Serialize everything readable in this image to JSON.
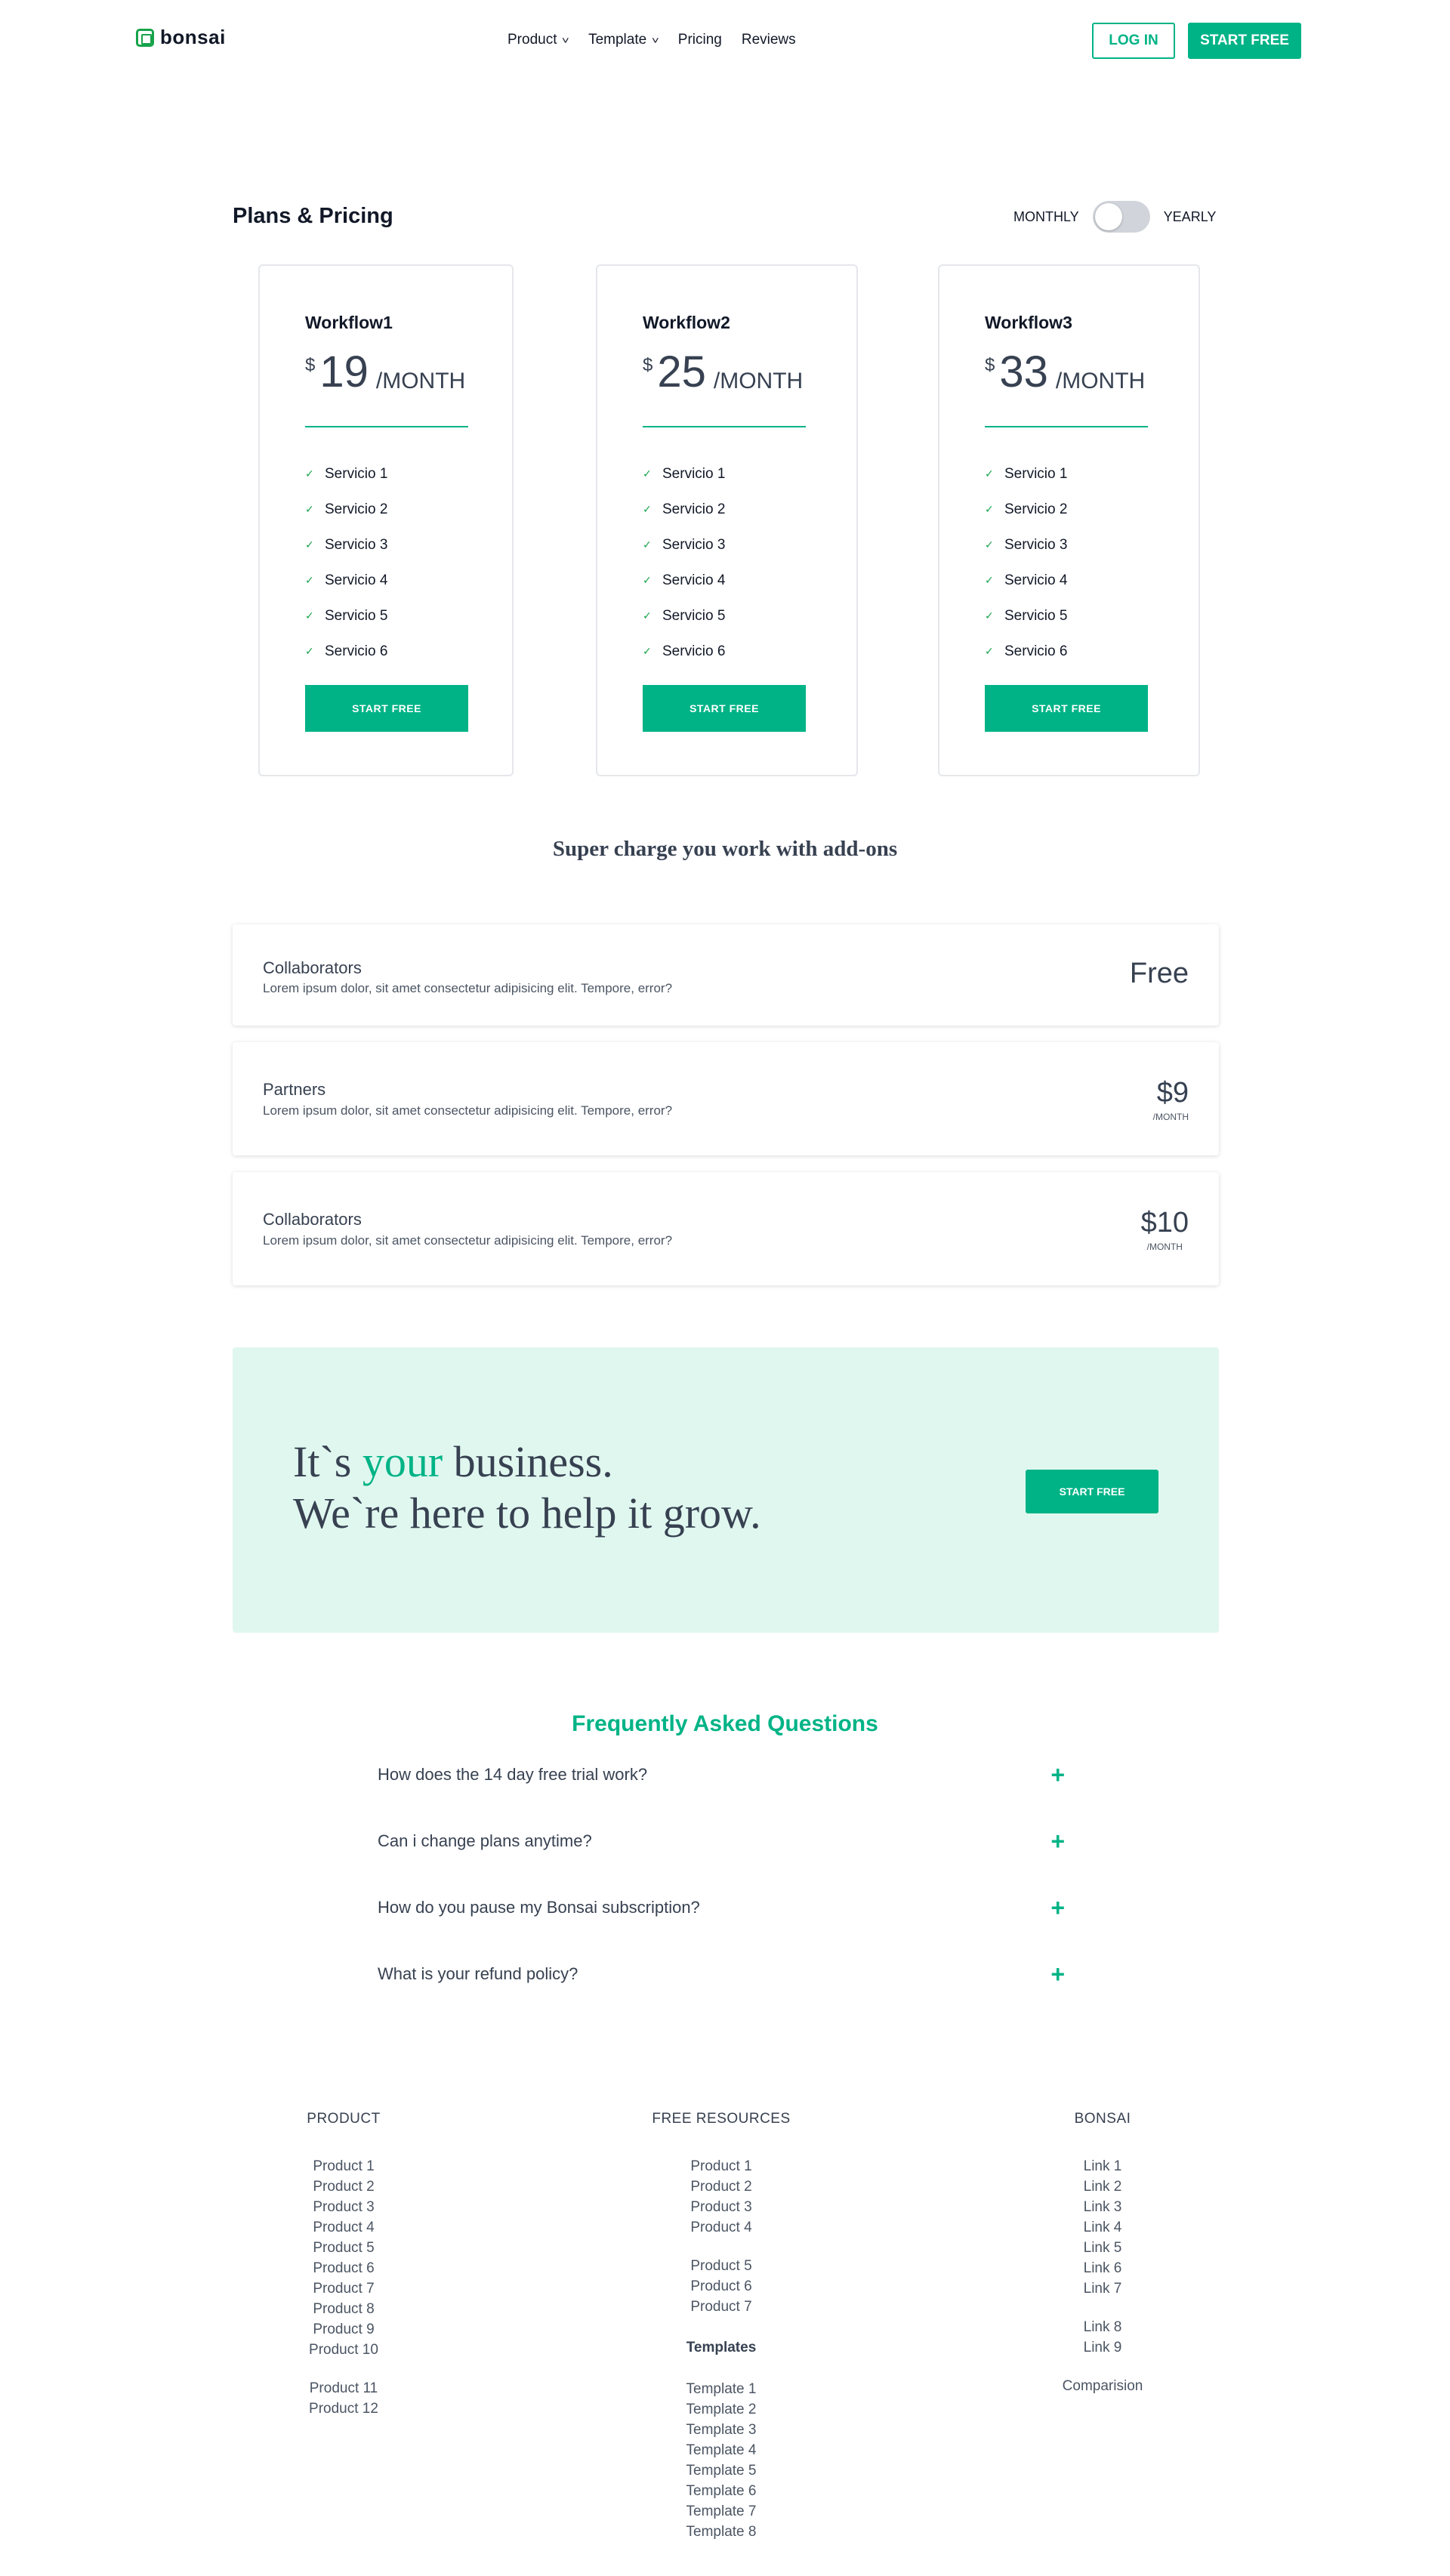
{
  "nav": {
    "logo": "bonsai",
    "links": [
      {
        "label": "Product",
        "dropdown": true
      },
      {
        "label": "Template",
        "dropdown": true
      },
      {
        "label": "Pricing",
        "dropdown": false
      },
      {
        "label": "Reviews",
        "dropdown": false
      }
    ],
    "login": "LOG IN",
    "start_free": "START FREE"
  },
  "plans": {
    "title": "Plans & Pricing",
    "toggle": {
      "left": "MONTHLY",
      "right": "YEARLY",
      "state": "monthly"
    },
    "cards": [
      {
        "name": "Workflow1",
        "currency": "$",
        "amount": "19",
        "period": "/MONTH",
        "features": [
          "Servicio 1",
          "Servicio 2",
          "Servicio 3",
          "Servicio 4",
          "Servicio 5",
          "Servicio 6"
        ],
        "cta": "START FREE"
      },
      {
        "name": "Workflow2",
        "currency": "$",
        "amount": "25",
        "period": "/MONTH",
        "features": [
          "Servicio 1",
          "Servicio 2",
          "Servicio 3",
          "Servicio 4",
          "Servicio 5",
          "Servicio 6"
        ],
        "cta": "START FREE"
      },
      {
        "name": "Workflow3",
        "currency": "$",
        "amount": "33",
        "period": "/MONTH",
        "features": [
          "Servicio 1",
          "Servicio 2",
          "Servicio 3",
          "Servicio 4",
          "Servicio 5",
          "Servicio 6"
        ],
        "cta": "START FREE"
      }
    ]
  },
  "addons": {
    "title": "Super charge you work with add-ons",
    "items": [
      {
        "name": "Collaborators",
        "desc": "Lorem ipsum dolor, sit amet consectetur adipisicing elit. Tempore, error?",
        "price": "Free",
        "period": ""
      },
      {
        "name": "Partners",
        "desc": "Lorem ipsum dolor, sit amet consectetur adipisicing elit. Tempore, error?",
        "price": "$9",
        "period": "/MONTH"
      },
      {
        "name": "Collaborators",
        "desc": "Lorem ipsum dolor, sit amet consectetur adipisicing elit. Tempore, error?",
        "price": "$10",
        "period": "/MONTH"
      }
    ]
  },
  "cta": {
    "line1_before": "It`s ",
    "line1_accent": "your",
    "line1_after": " business.",
    "line2": "We`re here to help it grow.",
    "button": "START FREE"
  },
  "faq": {
    "title": "Frequently Asked Questions",
    "questions": [
      "How does the 14 day free trial work?",
      "Can i change plans anytime?",
      "How do you pause my Bonsai subscription?",
      "What is your refund policy?"
    ]
  },
  "footer": {
    "product": {
      "heading": "PRODUCT",
      "group1": [
        "Product 1",
        "Product 2",
        "Product 3",
        "Product 4",
        "Product 5",
        "Product 6",
        "Product 7",
        "Product 8",
        "Product 9",
        "Product 10"
      ],
      "group2": [
        "Product 11",
        "Product 12"
      ]
    },
    "resources": {
      "heading": "FREE RESOURCES",
      "group1": [
        "Product 1",
        "Product 2",
        "Product 3",
        "Product 4"
      ],
      "group2": [
        "Product 5",
        "Product 6",
        "Product 7"
      ],
      "templates_heading": "Templates",
      "templates": [
        "Template 1",
        "Template 2",
        "Template 3",
        "Template 4",
        "Template 5",
        "Template 6",
        "Template 7",
        "Template 8"
      ]
    },
    "bonsai": {
      "heading": "BONSAI",
      "group1": [
        "Link 1",
        "Link 2",
        "Link 3",
        "Link 4",
        "Link 5",
        "Link 6",
        "Link 7"
      ],
      "group2": [
        "Link 8",
        "Link 9"
      ],
      "extra": "Comparision"
    }
  },
  "colors": {
    "accent": "#00b386",
    "cta_bg": "#e0f7ef",
    "text": "#374151"
  }
}
